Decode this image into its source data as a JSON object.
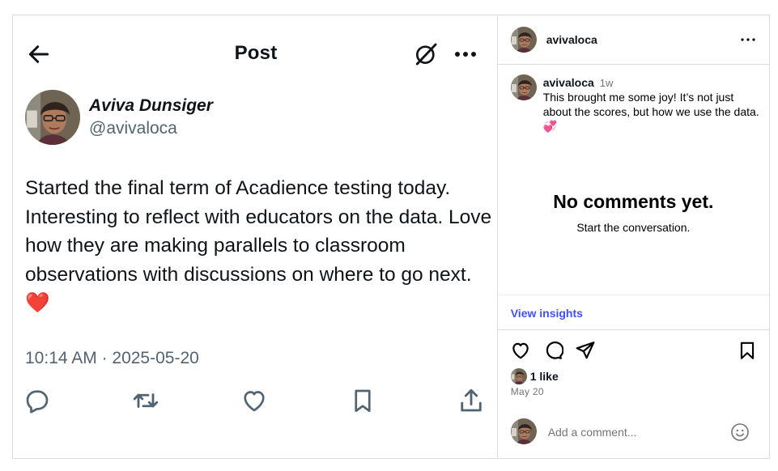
{
  "tweet": {
    "header_title": "Post",
    "author_name": "Aviva Dunsiger",
    "author_handle": "@avivaloca",
    "text": "Started the final term of Acadience testing today. Interesting to reflect with educators on the data. Love how they are making parallels to classroom observations with discussions on where to go next.",
    "emoji": "❤️",
    "timestamp": "10:14 AM · 2025-05-20",
    "icons": [
      "back-arrow-icon",
      "grok-icon",
      "more-icon",
      "reply-icon",
      "retweet-icon",
      "like-icon",
      "bookmark-icon",
      "share-icon"
    ]
  },
  "instagram": {
    "username": "avivaloca",
    "caption": {
      "username": "avivaloca",
      "time": "1w",
      "text": "This brought me some joy! It’s not just about the scores, but how we use the data. 💞"
    },
    "empty_title": "No comments yet.",
    "empty_subtitle": "Start the conversation.",
    "insights_label": "View insights",
    "likes": "1 like",
    "date": "May 20",
    "comment_placeholder": "Add a comment...",
    "accent_color": "#4150f7",
    "icons": [
      "heart-icon",
      "comment-icon",
      "send-icon",
      "save-icon",
      "emoji-icon",
      "more-icon"
    ]
  }
}
